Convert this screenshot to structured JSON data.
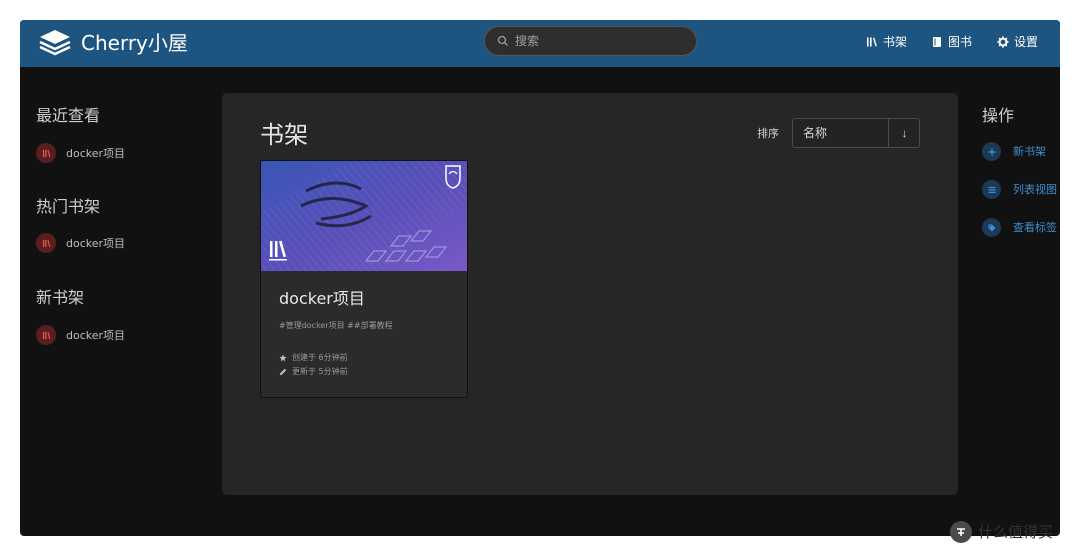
{
  "header": {
    "brand": "Cherry小屋",
    "search_placeholder": "搜索",
    "nav": [
      {
        "label": "书架",
        "icon": "shelf-icon"
      },
      {
        "label": "图书",
        "icon": "book-icon"
      },
      {
        "label": "设置",
        "icon": "gear-icon"
      }
    ]
  },
  "sidebar": {
    "recent": {
      "title": "最近查看",
      "items": [
        {
          "label": "docker项目"
        }
      ]
    },
    "popular": {
      "title": "热门书架",
      "items": [
        {
          "label": "docker项目"
        }
      ]
    },
    "new": {
      "title": "新书架",
      "items": [
        {
          "label": "docker项目"
        }
      ]
    }
  },
  "main": {
    "title": "书架",
    "sort": {
      "label": "排序",
      "value": "名称",
      "direction": "↓"
    },
    "cards": [
      {
        "title": "docker项目",
        "tags": "#管理docker项目 ##部署教程",
        "created": "创建于 6分钟前",
        "updated": "更新于 5分钟前"
      }
    ]
  },
  "actions": {
    "title": "操作",
    "items": [
      {
        "label": "新书架",
        "icon": "plus-icon"
      },
      {
        "label": "列表视图",
        "icon": "list-icon"
      },
      {
        "label": "查看标签",
        "icon": "tag-icon"
      }
    ]
  },
  "watermark": {
    "text": "什么值得买"
  },
  "colors": {
    "header": "#1d5480",
    "background": "#111111",
    "panel": "#262626",
    "accent": "#3d8fd1",
    "book_badge": "#5a1e1e"
  }
}
